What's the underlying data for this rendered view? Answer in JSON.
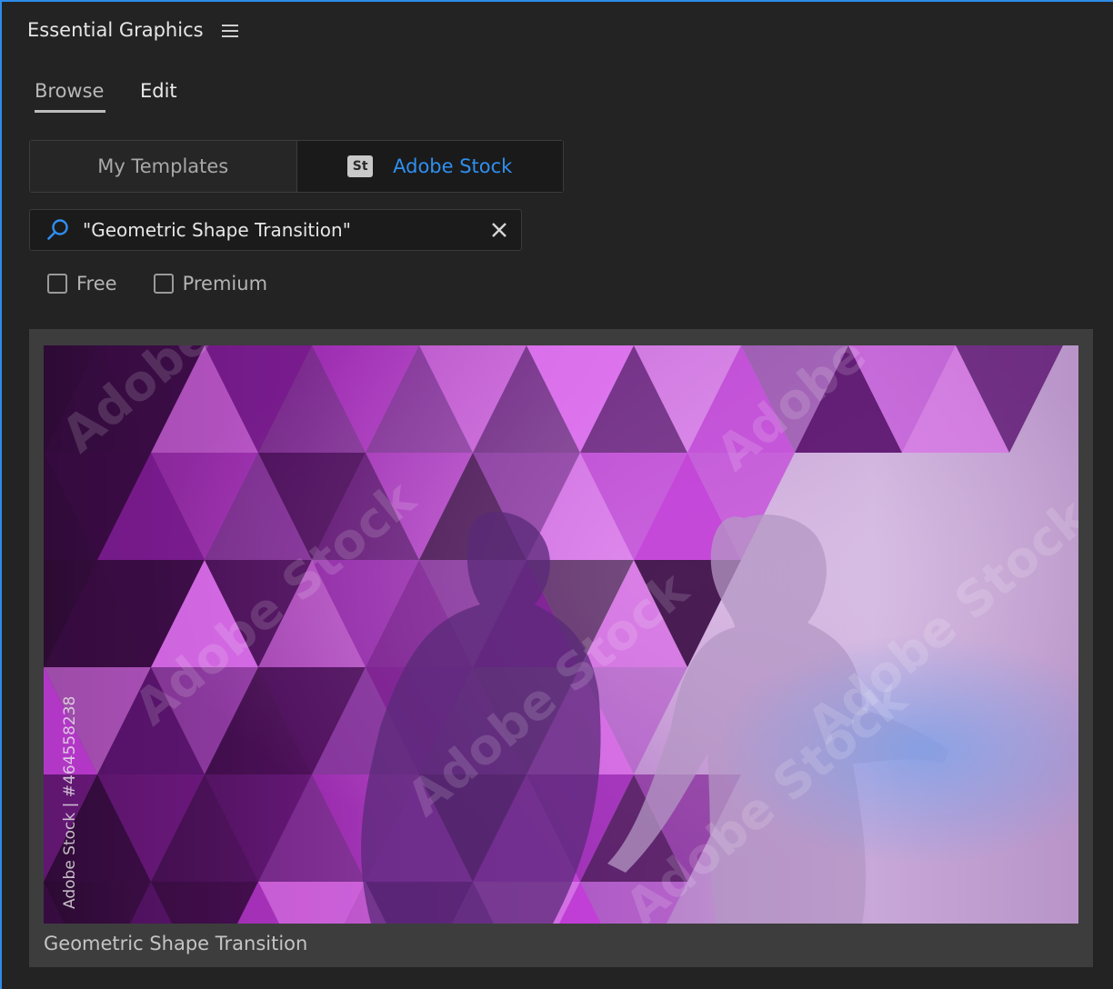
{
  "panel": {
    "title": "Essential Graphics",
    "menu_icon": "hamburger-menu-icon",
    "accent_color": "#2d8ceb"
  },
  "tabs": [
    {
      "label": "Browse",
      "active": true
    },
    {
      "label": "Edit",
      "active": false
    }
  ],
  "source_toggle": {
    "templates_label": "My Templates",
    "stock_badge": "St",
    "stock_label": "Adobe Stock",
    "selected": "Adobe Stock"
  },
  "search": {
    "value": "\"Geometric Shape Transition\"",
    "placeholder": "",
    "icon": "search-icon",
    "clear_icon": "close-icon"
  },
  "filters": [
    {
      "label": "Free",
      "checked": false
    },
    {
      "label": "Premium",
      "checked": false
    }
  ],
  "results": [
    {
      "title": "Geometric Shape Transition",
      "watermark": "Adobe Stock",
      "asset_id_text": "Adobe Stock | #464558238"
    }
  ]
}
